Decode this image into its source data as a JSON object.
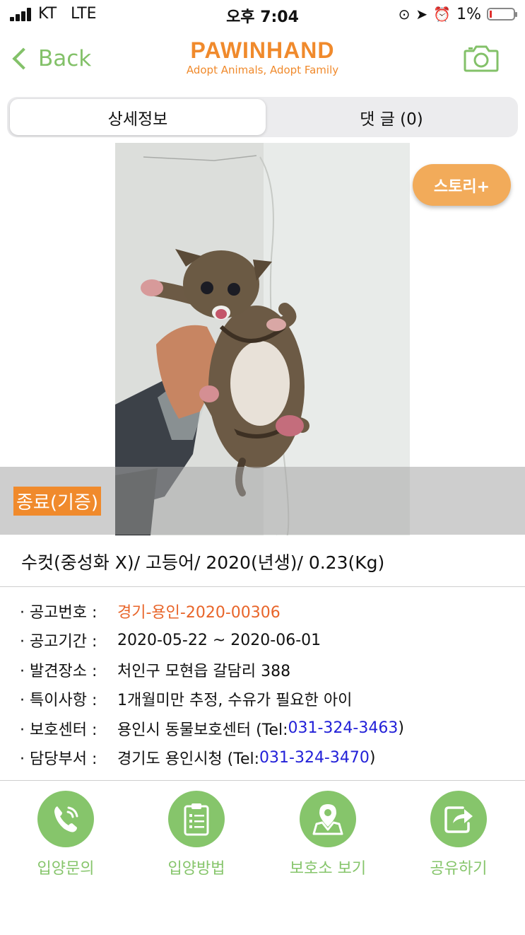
{
  "status_bar": {
    "carrier": "KT",
    "network": "LTE",
    "time": "오후 7:04",
    "battery": "1%",
    "battery_level": 0.01
  },
  "header": {
    "back_label": "Back",
    "logo_title": "PAWINHAND",
    "logo_subtitle": "Adopt Animals, Adopt Family"
  },
  "tabs": {
    "detail": "상세정보",
    "comments": "댓 글 (0)"
  },
  "photo": {
    "story_button": "스토리+",
    "status_label": "종료(기증)"
  },
  "summary": "수컷(중성화 X)/ 고등어/ 2020(년생)/ 0.23(Kg)",
  "info": [
    {
      "key": "· 공고번호 :",
      "value": "경기-용인-2020-00306"
    },
    {
      "key": "· 공고기간 :",
      "value": "2020-05-22 ~ 2020-06-01"
    },
    {
      "key": "· 발견장소 :",
      "value": "처인구 모현읍 갈담리 388"
    },
    {
      "key": "· 특이사항 :",
      "value": "1개월미만 추정, 수유가 필요한 아이"
    },
    {
      "key": "· 보호센터 :",
      "value": "용인시 동물보호센터 (Tel: ",
      "phone": "031-324-3463",
      "suffix": ")"
    },
    {
      "key": "· 담당부서 :",
      "value": "경기도 용인시청 (Tel: ",
      "phone": "031-324-3470",
      "suffix": ")"
    }
  ],
  "actions": [
    {
      "label": "입양문의",
      "icon": "phone-icon"
    },
    {
      "label": "입양방법",
      "icon": "clipboard-icon"
    },
    {
      "label": "보호소 보기",
      "icon": "map-pin-icon"
    },
    {
      "label": "공유하기",
      "icon": "share-icon"
    }
  ],
  "colors": {
    "brand_orange": "#f08a2c",
    "accent_green": "#86c56b",
    "link_blue": "#2220d8",
    "notice_orange": "#e8652a"
  }
}
